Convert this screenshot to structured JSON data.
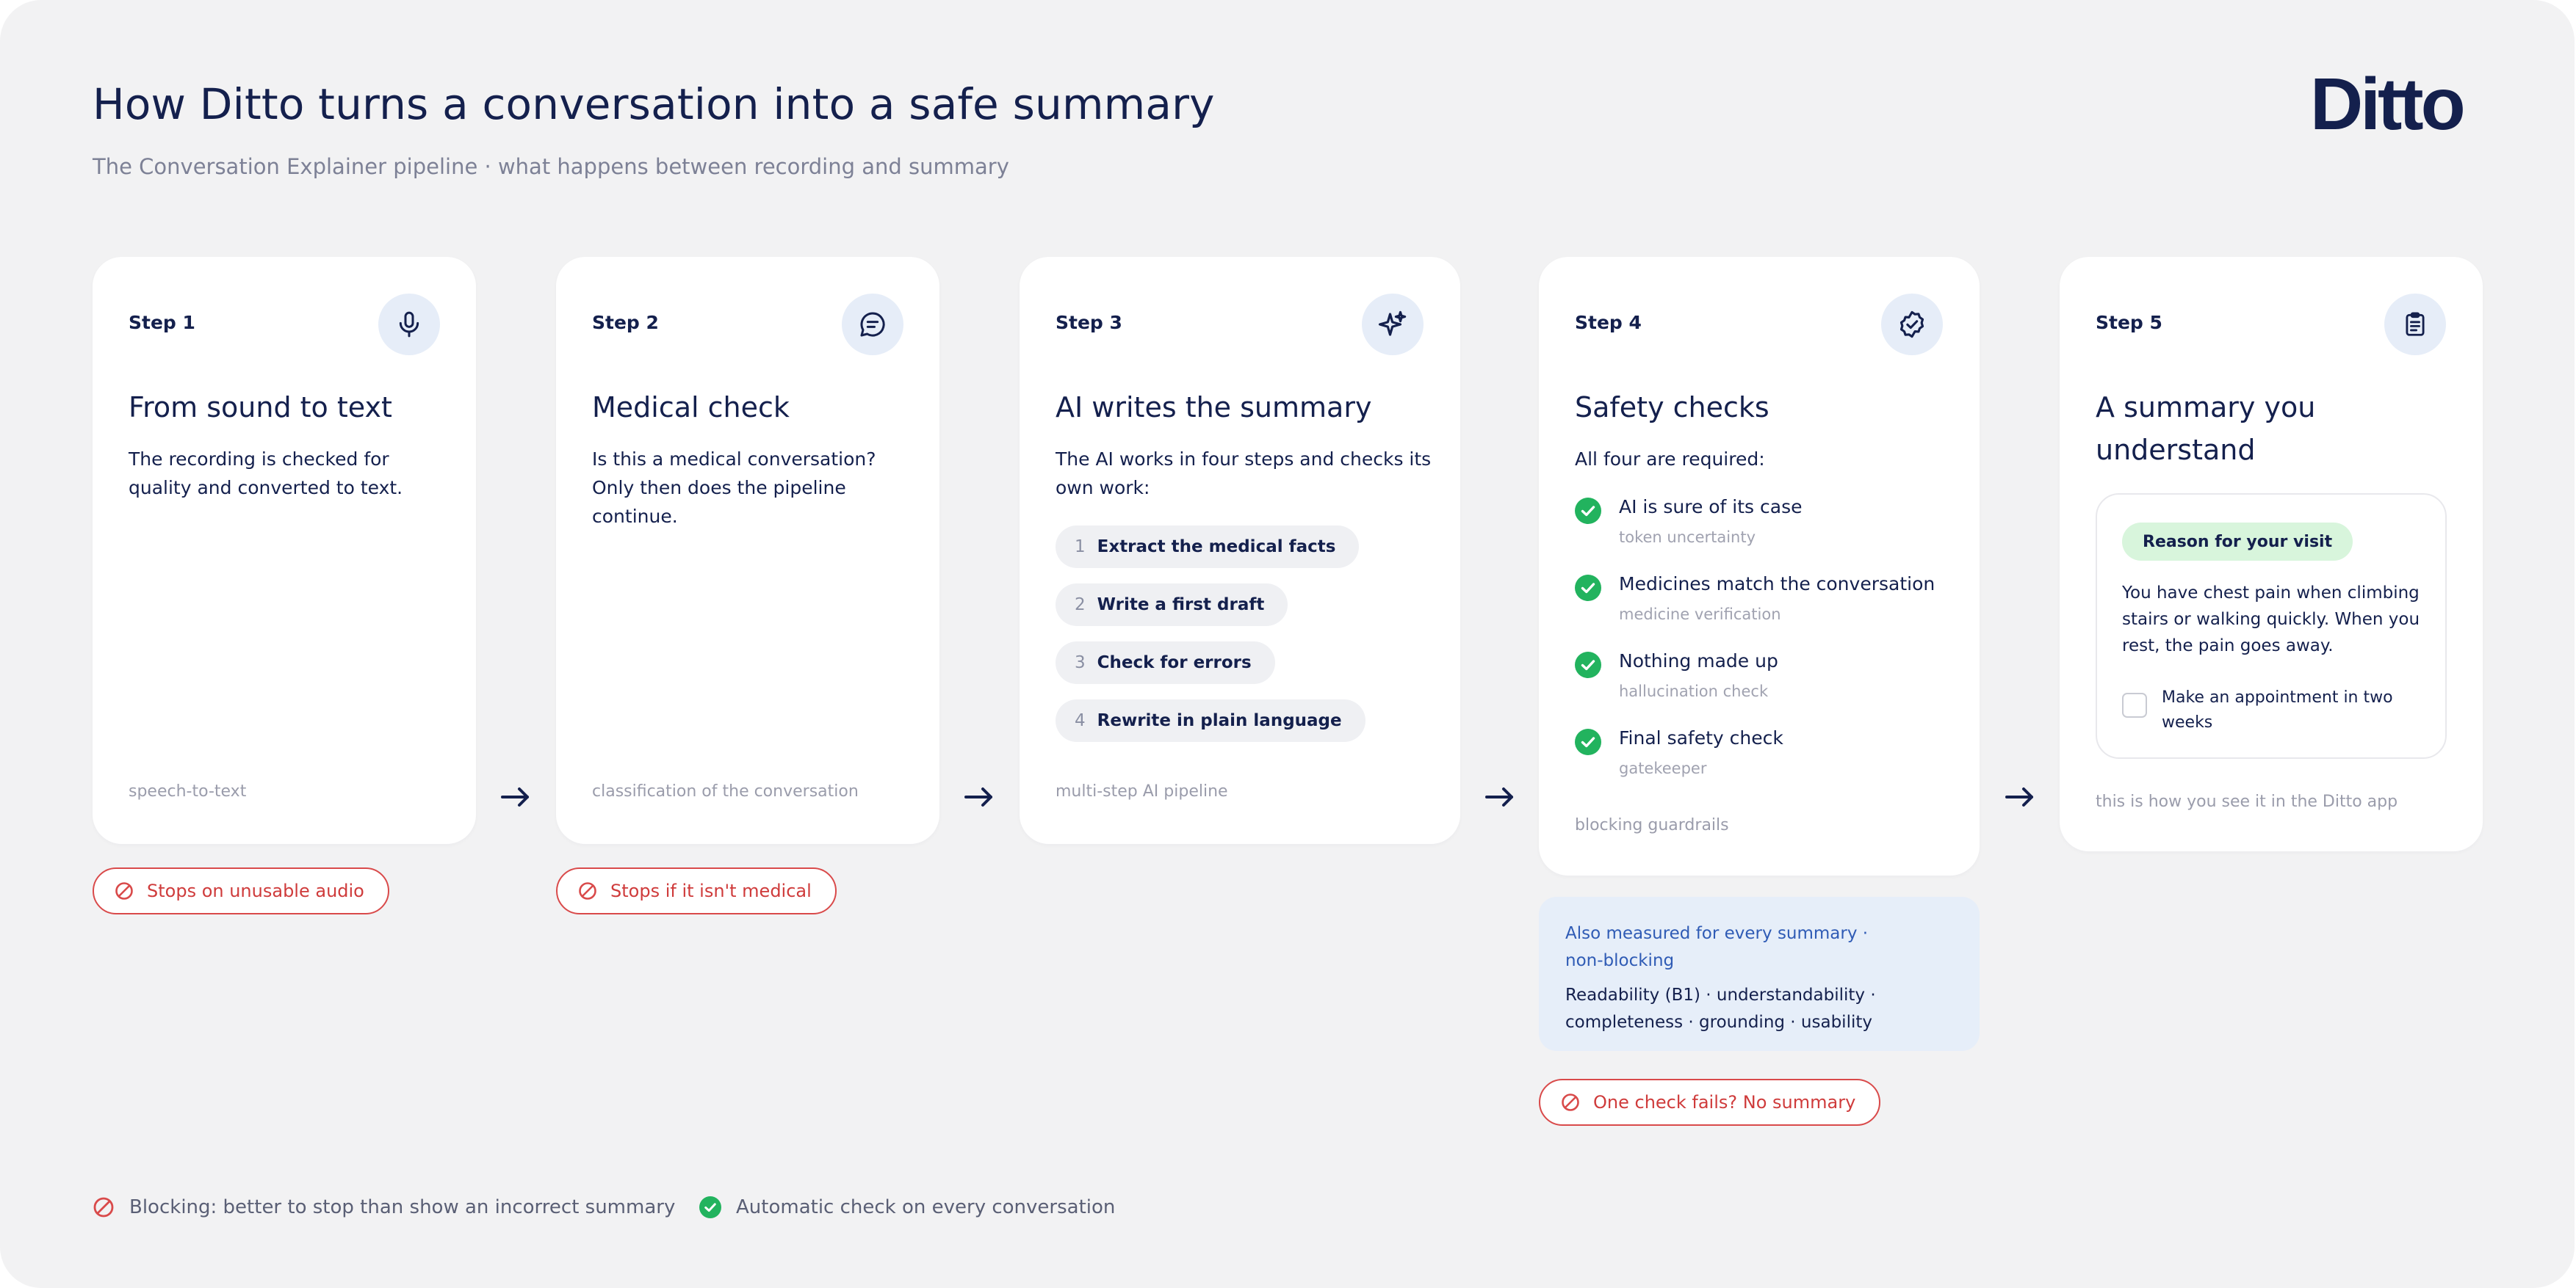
{
  "header": {
    "title": "How Ditto turns a conversation into a safe summary",
    "subtitle": "The Conversation Explainer pipeline · what happens between recording and summary",
    "logo_text": "Ditto"
  },
  "colors": {
    "navy": "#14204d",
    "background": "#f2f2f3",
    "card": "#ffffff",
    "icon_bg": "#e6edf8",
    "blocking_red": "#cf3b3b",
    "check_green": "#22b35e",
    "info_blue": "#2f5bb5",
    "tag_green": "#d8f5dc"
  },
  "steps": [
    {
      "label": "Step 1",
      "icon": "microphone-icon",
      "title": "From sound to text",
      "description": "The recording is checked for quality and converted to text.",
      "footer": "speech-to-text",
      "stop": "Stops on unusable audio"
    },
    {
      "label": "Step 2",
      "icon": "chat-bubble-icon",
      "title": "Medical check",
      "description": "Is this a medical conversation? Only then does the pipeline continue.",
      "footer": "classification of the conversation",
      "stop": "Stops if it isn't medical"
    },
    {
      "label": "Step 3",
      "icon": "sparkle-icon",
      "title": "AI writes the summary",
      "description": "The AI works in four steps and checks its own work:",
      "substeps": [
        {
          "num": "1",
          "text": "Extract the medical facts"
        },
        {
          "num": "2",
          "text": "Write a first draft"
        },
        {
          "num": "3",
          "text": "Check for errors"
        },
        {
          "num": "4",
          "text": "Rewrite in plain language"
        }
      ],
      "footer": "multi-step AI pipeline"
    },
    {
      "label": "Step 4",
      "icon": "verified-badge-icon",
      "title": "Safety checks",
      "description": "All four are required:",
      "checks": [
        {
          "title": "AI is sure of its case",
          "sub": "token uncertainty"
        },
        {
          "title": "Medicines match the conversation",
          "sub": "medicine verification"
        },
        {
          "title": "Nothing made up",
          "sub": "hallucination check"
        },
        {
          "title": "Final safety check",
          "sub": "gatekeeper"
        }
      ],
      "footer": "blocking guardrails",
      "measured_title": "Also measured for every summary · non-blocking",
      "measured_body": "Readability (B1) · understandability · completeness · grounding · usability",
      "stop": "One check fails? No summary"
    },
    {
      "label": "Step 5",
      "icon": "clipboard-document-icon",
      "title": "A summary you understand",
      "app_tag": "Reason for your visit",
      "app_text": "You have chest pain when climbing stairs or walking quickly. When you rest, the pain goes away.",
      "app_todo": "Make an appointment in two weeks",
      "footer": "this is how you see it in the Ditto app"
    }
  ],
  "legend": {
    "blocking": "Blocking: better to stop than show an incorrect summary",
    "automatic": "Automatic check on every conversation"
  }
}
